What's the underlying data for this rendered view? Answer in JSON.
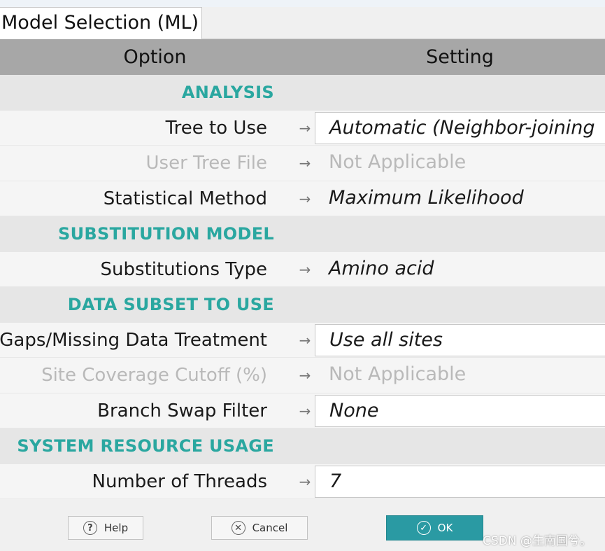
{
  "tab": {
    "title": "Model Selection (ML)"
  },
  "header": {
    "option": "Option",
    "setting": "Setting"
  },
  "arrow_glyph": "→",
  "sections": {
    "analysis": {
      "title": "ANALYSIS",
      "tree_to_use": {
        "label": "Tree to Use",
        "value": "Automatic (Neighbor-joining"
      },
      "user_tree_file": {
        "label": "User Tree File",
        "value": "Not Applicable"
      },
      "statistical_method": {
        "label": "Statistical Method",
        "value": "Maximum Likelihood"
      }
    },
    "substitution_model": {
      "title": "SUBSTITUTION MODEL",
      "substitutions_type": {
        "label": "Substitutions Type",
        "value": "Amino acid"
      }
    },
    "data_subset": {
      "title": "DATA SUBSET TO USE",
      "gaps_missing": {
        "label": "Gaps/Missing Data Treatment",
        "value": "Use all sites"
      },
      "site_coverage": {
        "label": "Site Coverage Cutoff (%)",
        "value": "Not Applicable"
      },
      "branch_swap": {
        "label": "Branch Swap Filter",
        "value": "None"
      }
    },
    "system_resource": {
      "title": "SYSTEM RESOURCE USAGE",
      "threads": {
        "label": "Number of Threads",
        "value": "7"
      }
    }
  },
  "buttons": {
    "help": {
      "label": "Help",
      "icon": "question-icon",
      "glyph": "?"
    },
    "cancel": {
      "label": "Cancel",
      "icon": "x-circle-icon",
      "glyph": "✕"
    },
    "ok": {
      "label": "OK",
      "icon": "check-circle-icon",
      "glyph": "✓"
    }
  },
  "watermark": "CSDN @生南国兮。",
  "colors": {
    "section_title": "#2aa7a0",
    "ok_button": "#2a9aa3",
    "header_bg": "#a7a7a7"
  }
}
